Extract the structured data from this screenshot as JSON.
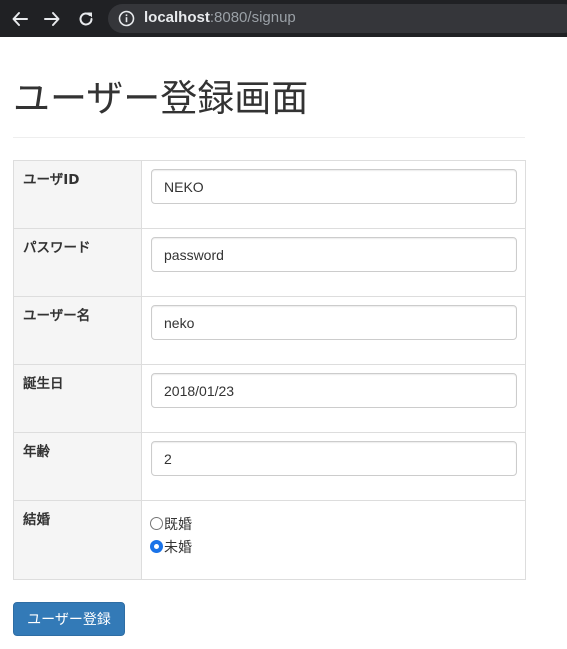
{
  "browser": {
    "url_host": "localhost",
    "url_rest": ":8080/signup",
    "chrome_color": "#202124"
  },
  "page": {
    "title": "ユーザー登録画面"
  },
  "form": {
    "user_id": {
      "label": "ユーザID",
      "value": "NEKO"
    },
    "password": {
      "label": "パスワード",
      "value": "password"
    },
    "user_name": {
      "label": "ユーザー名",
      "value": "neko"
    },
    "birthday": {
      "label": "誕生日",
      "value": "2018/01/23"
    },
    "age": {
      "label": "年齢",
      "value": "2"
    },
    "marriage": {
      "label": "結婚",
      "options": [
        {
          "label": "既婚",
          "checked": false
        },
        {
          "label": "未婚",
          "checked": true
        }
      ]
    },
    "submit_label": "ユーザー登録",
    "submit_color": "#337ab7"
  }
}
